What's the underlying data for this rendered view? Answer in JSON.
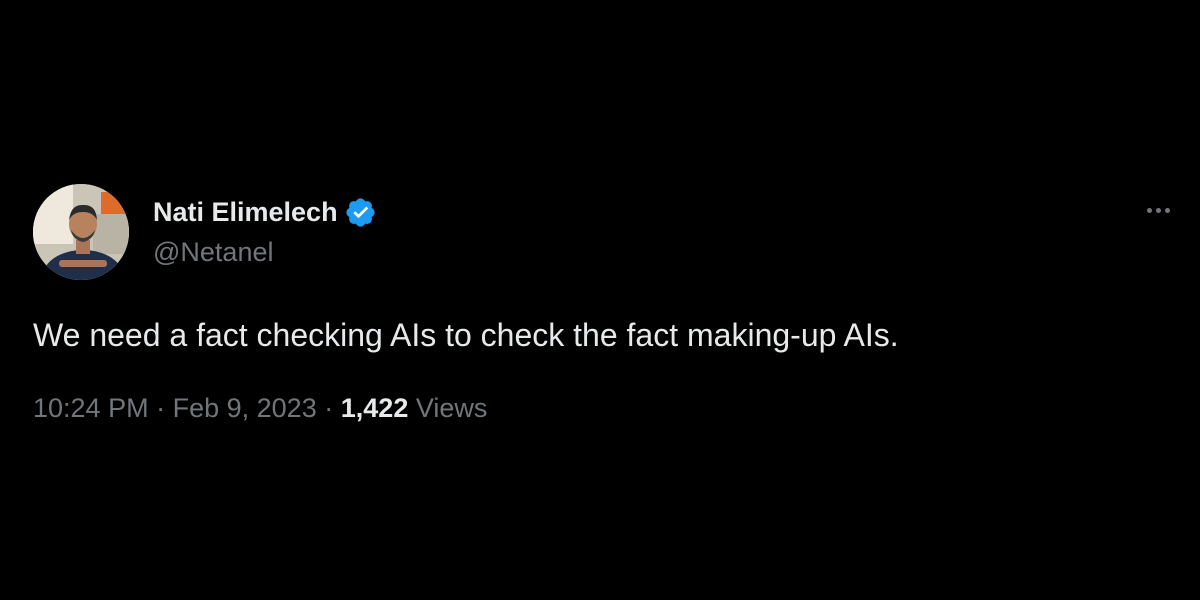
{
  "author": {
    "name": "Nati Elimelech",
    "handle": "@Netanel",
    "verified": true,
    "verified_color": "#1d9bf0",
    "avatar_icon": "profile-photo"
  },
  "menu": {
    "more_icon": "more-horizontal-icon"
  },
  "tweet": {
    "text": "We need a fact checking AIs to check the fact making-up AIs."
  },
  "meta": {
    "time": "10:24 PM",
    "separator": "·",
    "date": "Feb 9, 2023",
    "views_count": "1,422",
    "views_label": "Views"
  },
  "colors": {
    "background": "#000000",
    "primary_text": "#e7e9ea",
    "secondary_text": "#71767b"
  }
}
